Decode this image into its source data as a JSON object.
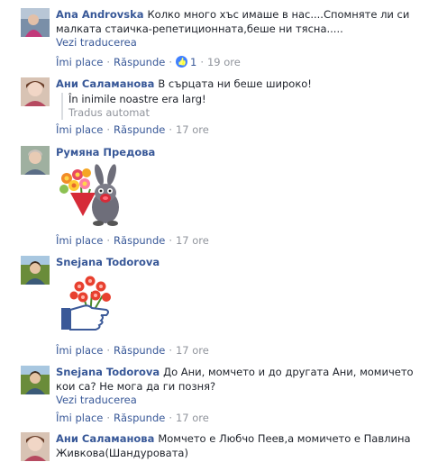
{
  "comments": [
    {
      "author": "Ana Androvska",
      "text": "Колко много хъс имаше в нас....Спомняте ли си малката стаичка-репетиционната,беше ни тясна.....",
      "translate": "Vezi traducerea",
      "actions": {
        "like": "Îmi place",
        "reply": "Răspunde",
        "reaction_count": "1",
        "time": "19 ore"
      }
    },
    {
      "author": "Ани Саламанова",
      "text": "В сърцата ни беше широко!",
      "auto_translation": "În inimile noastre era larg!",
      "auto_label": "Tradus automat",
      "actions": {
        "like": "Îmi place",
        "reply": "Răspunde",
        "time": "17 ore"
      }
    },
    {
      "author": "Румяна Предова",
      "sticker": "bunny-with-flowers-sticker",
      "actions": {
        "like": "Îmi place",
        "reply": "Răspunde",
        "time": "17 ore"
      }
    },
    {
      "author": "Snejana Todorova",
      "sticker": "hand-with-flowers-sticker",
      "actions": {
        "like": "Îmi place",
        "reply": "Răspunde",
        "time": "17 ore"
      }
    },
    {
      "author": "Snejana Todorova",
      "text": "До Ани, момчето и до другата Ани, момичето кои са? Не мога да ги позня?",
      "translate": "Vezi traducerea",
      "actions": {
        "like": "Îmi place",
        "reply": "Răspunde",
        "time": "17 ore"
      }
    },
    {
      "author": "Ани Саламанова",
      "text": "Момчето е Любчо Пеев,а момичето е Павлина Живкова(Шандуровата)"
    }
  ],
  "colors": {
    "link": "#385898",
    "meta": "#90949c",
    "text": "#1d2129",
    "like_badge": "#4080ff"
  }
}
